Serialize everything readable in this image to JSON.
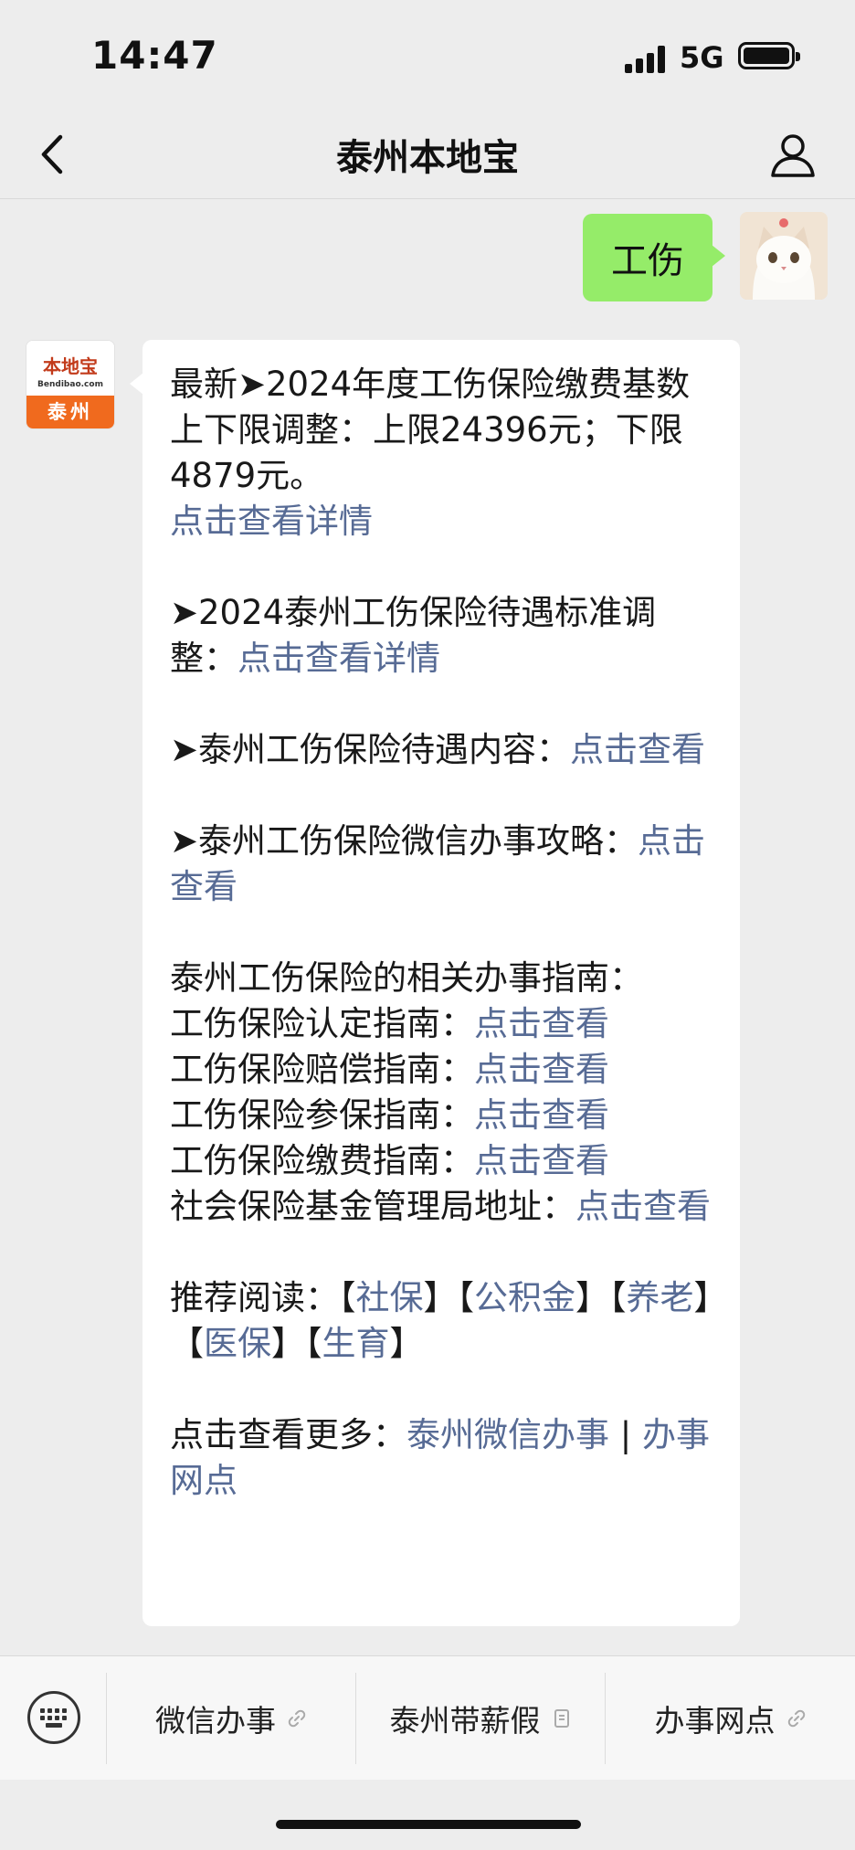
{
  "status_bar": {
    "time": "14:47",
    "network": "5G"
  },
  "nav": {
    "title": "泰州本地宝",
    "back_icon": "chevron-left-icon",
    "profile_icon": "person-icon"
  },
  "user_message": {
    "text": "工伤"
  },
  "bot_avatar": {
    "logo_text": "本地宝",
    "logo_sub": "Bendibao.com",
    "city": "泰州"
  },
  "bot_message": {
    "p1_text": "最新➤2024年度工伤保险缴费基数上下限调整：上限24396元；下限4879元。",
    "p1_link": "点击查看详情",
    "p2_text": "➤2024泰州工伤保险待遇标准调整：",
    "p2_link": "点击查看详情",
    "p3_text": "➤泰州工伤保险待遇内容：",
    "p3_link": "点击查看",
    "p4_text": "➤泰州工伤保险微信办事攻略：",
    "p4_link": "点击查看",
    "guide_heading": "泰州工伤保险的相关办事指南：",
    "guides": [
      {
        "label": "工伤保险认定指南：",
        "link": "点击查看"
      },
      {
        "label": "工伤保险赔偿指南：",
        "link": "点击查看"
      },
      {
        "label": "工伤保险参保指南：",
        "link": "点击查看"
      },
      {
        "label": "工伤保险缴费指南：",
        "link": "点击查看"
      },
      {
        "label": "社会保险基金管理局地址：",
        "link": "点击查看"
      }
    ],
    "recommend_label": "推荐阅读：",
    "recommend": [
      "社保",
      "公积金",
      "养老",
      "医保",
      "生育"
    ],
    "more_label": "点击查看更多：",
    "more_link1": "泰州微信办事",
    "more_sep": " | ",
    "more_link2": "办事网点"
  },
  "bottom_menu": {
    "keyboard_icon": "keyboard-icon",
    "items": [
      {
        "label": "微信办事",
        "icon": "link-icon"
      },
      {
        "label": "泰州带薪假",
        "icon": "document-icon"
      },
      {
        "label": "办事网点",
        "icon": "link-icon"
      }
    ]
  },
  "colors": {
    "background": "#ededed",
    "user_bubble": "#95ec69",
    "link": "#576b95",
    "logo_orange": "#f06a1e"
  }
}
